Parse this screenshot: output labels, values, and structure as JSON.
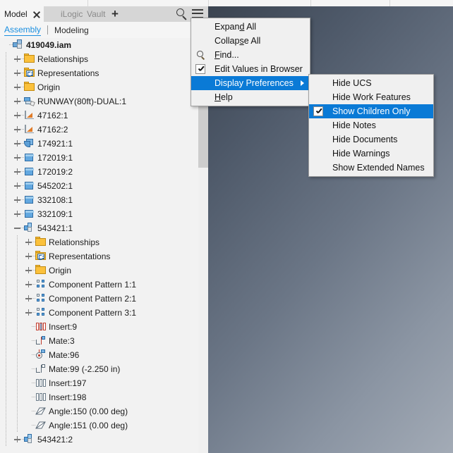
{
  "window": {
    "tabbar": {
      "active_tab": "Model",
      "close_icon": "close-icon",
      "inactive_tabs": [
        "iLogic",
        "Vault"
      ],
      "add_tab_label": "+",
      "search_icon": "search-icon",
      "menu_icon": "hamburger-menu-icon"
    },
    "subtabs": {
      "active": "Assembly",
      "items": [
        "Modeling"
      ]
    }
  },
  "tree": {
    "root": {
      "label": "419049.iam",
      "icon": "assembly-icon"
    },
    "nodes": [
      {
        "label": "Relationships",
        "icon": "folder-icon",
        "indent": 1,
        "expander": "plus"
      },
      {
        "label": "Representations",
        "icon": "representations-icon",
        "indent": 1,
        "expander": "plus"
      },
      {
        "label": "Origin",
        "icon": "folder-icon",
        "indent": 1,
        "expander": "plus"
      },
      {
        "label": "RUNWAY(80ft)-DUAL:1",
        "icon": "runway-assembly-icon",
        "indent": 1,
        "expander": "plus"
      },
      {
        "label": "47162:1",
        "icon": "wedge-part-icon",
        "indent": 1,
        "expander": "plus"
      },
      {
        "label": "47162:2",
        "icon": "wedge-part-icon",
        "indent": 1,
        "expander": "plus"
      },
      {
        "label": "174921:1",
        "icon": "sheet-part-icon",
        "indent": 1,
        "expander": "plus"
      },
      {
        "label": "172019:1",
        "icon": "part-icon",
        "indent": 1,
        "expander": "plus"
      },
      {
        "label": "172019:2",
        "icon": "part-icon",
        "indent": 1,
        "expander": "plus"
      },
      {
        "label": "545202:1",
        "icon": "part-icon",
        "indent": 1,
        "expander": "plus"
      },
      {
        "label": "332108:1",
        "icon": "part-icon",
        "indent": 1,
        "expander": "plus"
      },
      {
        "label": "332109:1",
        "icon": "part-icon",
        "indent": 1,
        "expander": "plus"
      },
      {
        "label": "543421:1",
        "icon": "subassembly-icon",
        "indent": 1,
        "expander": "minus"
      },
      {
        "label": "Relationships",
        "icon": "folder-icon",
        "indent": 2,
        "expander": "plus"
      },
      {
        "label": "Representations",
        "icon": "representations-icon",
        "indent": 2,
        "expander": "plus"
      },
      {
        "label": "Origin",
        "icon": "folder-icon",
        "indent": 2,
        "expander": "plus"
      },
      {
        "label": "Component Pattern 1:1",
        "icon": "component-pattern-icon",
        "indent": 2,
        "expander": "plus"
      },
      {
        "label": "Component Pattern 2:1",
        "icon": "component-pattern-icon",
        "indent": 2,
        "expander": "plus"
      },
      {
        "label": "Component Pattern 3:1",
        "icon": "component-pattern-icon",
        "indent": 2,
        "expander": "plus"
      },
      {
        "label": "Insert:9",
        "icon": "insert-constraint-icon",
        "indent": 2,
        "expander": "none"
      },
      {
        "label": "Mate:3",
        "icon": "mate-constraint-icon",
        "indent": 2,
        "expander": "none"
      },
      {
        "label": "Mate:96",
        "icon": "mate-axis-icon",
        "indent": 2,
        "expander": "none"
      },
      {
        "label": "Mate:99 (-2.250 in)",
        "icon": "mate-plain-icon",
        "indent": 2,
        "expander": "none"
      },
      {
        "label": "Insert:197",
        "icon": "insert-gray-icon",
        "indent": 2,
        "expander": "none"
      },
      {
        "label": "Insert:198",
        "icon": "insert-gray-icon",
        "indent": 2,
        "expander": "none"
      },
      {
        "label": "Angle:150 (0.00 deg)",
        "icon": "angle-constraint-icon",
        "indent": 2,
        "expander": "none"
      },
      {
        "label": "Angle:151 (0.00 deg)",
        "icon": "angle-constraint-icon",
        "indent": 2,
        "expander": "none"
      },
      {
        "label": "543421:2",
        "icon": "subassembly-icon",
        "indent": 1,
        "expander": "plus"
      }
    ]
  },
  "context_menu": {
    "items": [
      {
        "label": "Expand All",
        "accel": "d",
        "check": false,
        "icon": null,
        "submenu": false,
        "selected": false
      },
      {
        "label": "Collapse All",
        "accel": "s",
        "check": false,
        "icon": null,
        "submenu": false,
        "selected": false
      },
      {
        "label": "Find...",
        "accel": "F",
        "check": false,
        "icon": "find-icon",
        "submenu": false,
        "selected": false
      },
      {
        "label": "Edit Values in Browser",
        "accel": null,
        "check": true,
        "icon": null,
        "submenu": false,
        "selected": false
      },
      {
        "label": "Display Preferences",
        "accel": null,
        "check": false,
        "icon": null,
        "submenu": true,
        "selected": true
      },
      {
        "label": "Help",
        "accel": "H",
        "check": false,
        "icon": null,
        "submenu": false,
        "selected": false
      }
    ]
  },
  "submenu": {
    "items": [
      {
        "label": "Hide UCS",
        "check": false,
        "selected": false
      },
      {
        "label": "Hide Work Features",
        "check": false,
        "selected": false
      },
      {
        "label": "Show Children Only",
        "check": true,
        "selected": true
      },
      {
        "label": "Hide Notes",
        "check": false,
        "selected": false
      },
      {
        "label": "Hide Documents",
        "check": false,
        "selected": false
      },
      {
        "label": "Hide Warnings",
        "check": false,
        "selected": false
      },
      {
        "label": "Show Extended Names",
        "check": false,
        "selected": false
      }
    ]
  },
  "scrollbar": {
    "thumb_top": 0,
    "thumb_height": 184
  },
  "colors": {
    "accent": "#0a7ad6",
    "link": "#1a8fe0",
    "folder": "#fbc13c",
    "part": "#63a8e0",
    "constraint_red": "#c03a2b",
    "viewport_dark": "#3b4450",
    "viewport_light": "#a3abb6"
  }
}
